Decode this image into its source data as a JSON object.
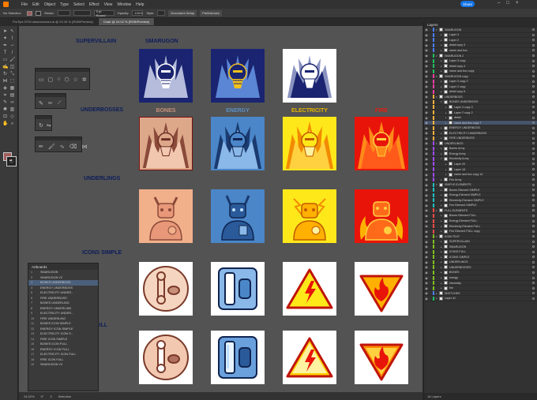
{
  "menu": [
    "File",
    "Edit",
    "Object",
    "Type",
    "Select",
    "Effect",
    "View",
    "Window",
    "Help"
  ],
  "share_label": "Share",
  "control": {
    "selection": "No Selection",
    "stroke_label": "Stroke:",
    "brush": "5 pt. Round",
    "opacity_label": "Opacity:",
    "opacity_value": "100%",
    "style_label": "Style:",
    "doc_setup": "Document Setup",
    "preferences": "Preferences"
  },
  "tabs": [
    {
      "label": "ProTips DTM dreamvectors.ai @ 24.15 % (RGB/Preview)",
      "active": false
    },
    {
      "label": "Chart @ 24.02 % (RGB/Preview)",
      "active": true
    }
  ],
  "canvas": {
    "rows": [
      "SUPERVILLAIN",
      "UNDERBOSSES",
      "UNDERLINGS",
      "ICONS SIMPLE",
      "ICONS FULL"
    ],
    "top_labels": [
      "SMARUGON"
    ],
    "element_labels": [
      "BONES",
      "ENERGY",
      "ELECTRICITY",
      "FIRE"
    ],
    "label_colors": [
      "#c8907a",
      "#5b8fc8",
      "#e8b800",
      "#e02010"
    ]
  },
  "artboards_panel": {
    "title": "Artboards",
    "items": [
      {
        "n": "1",
        "name": "SMARUGON"
      },
      {
        "n": "2",
        "name": "SMARUGON V2"
      },
      {
        "n": "3",
        "name": "BONES UNDERBOSS"
      },
      {
        "n": "4",
        "name": "ENERGY UNDERBOSS"
      },
      {
        "n": "5",
        "name": "ELECTRICITY UNDER..."
      },
      {
        "n": "6",
        "name": "FIRE UNDERBOSS"
      },
      {
        "n": "7",
        "name": "BONES UNDERLING"
      },
      {
        "n": "8",
        "name": "ENERGY UNDERLING"
      },
      {
        "n": "9",
        "name": "ELECTRICITY UNDER..."
      },
      {
        "n": "10",
        "name": "FIRE UNDERLING"
      },
      {
        "n": "11",
        "name": "BONES ICON SIMPLE"
      },
      {
        "n": "12",
        "name": "ENERGY ICON SIMPLE"
      },
      {
        "n": "13",
        "name": "ELECTRICITY ICON S..."
      },
      {
        "n": "14",
        "name": "FIRE ICON SIMPLE"
      },
      {
        "n": "15",
        "name": "BONES ICON FULL"
      },
      {
        "n": "16",
        "name": "ENERGY ICON FULL"
      },
      {
        "n": "17",
        "name": "ELECTRICITY ICON FULL"
      },
      {
        "n": "18",
        "name": "FIRE ICON FULL"
      },
      {
        "n": "19",
        "name": "SMARUGON V3"
      }
    ],
    "selected_index": 2
  },
  "layers_panel": {
    "title": "Layers",
    "footer": "16 Layers",
    "rows": [
      {
        "name": "SMARUGON",
        "indent": 0,
        "color": "#4a7cff",
        "open": true
      },
      {
        "name": "Layer 3",
        "indent": 1,
        "color": "#4a7cff"
      },
      {
        "name": "Layer 2",
        "indent": 1,
        "color": "#4a7cff"
      },
      {
        "name": "detail copy 3",
        "indent": 1,
        "color": "#4a7cff"
      },
      {
        "name": "name and box",
        "indent": 1,
        "color": "#4a7cff"
      },
      {
        "name": "SMARUGON 2",
        "indent": 0,
        "color": "#1fbf5f",
        "open": true
      },
      {
        "name": "Layer 3 copy",
        "indent": 1,
        "color": "#1fbf5f"
      },
      {
        "name": "detail copy 4",
        "indent": 1,
        "color": "#1fbf5f"
      },
      {
        "name": "name and box copy",
        "indent": 1,
        "color": "#1fbf5f"
      },
      {
        "name": "SMARUGON copy",
        "indent": 0,
        "color": "#ff3fa7",
        "open": true
      },
      {
        "name": "Layer 3 copy 2",
        "indent": 1,
        "color": "#ff3fa7"
      },
      {
        "name": "Layer 2 copy",
        "indent": 1,
        "color": "#ff3fa7"
      },
      {
        "name": "detail copy 5",
        "indent": 1,
        "color": "#ff3fa7"
      },
      {
        "name": "UNDERBOSS",
        "indent": 0,
        "color": "#ffb13b",
        "open": true
      },
      {
        "name": "BONES UNDERBOSS",
        "indent": 1,
        "color": "#ffb13b",
        "open": true
      },
      {
        "name": "Layer 3 copy 3",
        "indent": 2,
        "color": "#ffb13b"
      },
      {
        "name": "Layer 2 copy 2",
        "indent": 2,
        "color": "#ffb13b"
      },
      {
        "name": "detail",
        "indent": 2,
        "color": "#ffb13b"
      },
      {
        "name": "name and box copy 7",
        "indent": 2,
        "color": "#ffb13b",
        "sel": true
      },
      {
        "name": "ENERGY UNDERBOSS",
        "indent": 1,
        "color": "#ffb13b"
      },
      {
        "name": "ELECTRICITY UNDERBOSS",
        "indent": 1,
        "color": "#ffb13b"
      },
      {
        "name": "FIRE UNDERBOSS",
        "indent": 1,
        "color": "#ffb13b"
      },
      {
        "name": "UNDERLINGS",
        "indent": 0,
        "color": "#9f4aff",
        "open": true
      },
      {
        "name": "Bones Army",
        "indent": 1,
        "color": "#9f4aff"
      },
      {
        "name": "Energy Army",
        "indent": 1,
        "color": "#9f4aff"
      },
      {
        "name": "Electricity Army",
        "indent": 1,
        "color": "#9f4aff",
        "open": true
      },
      {
        "name": "Layer 20",
        "indent": 2,
        "color": "#9f4aff"
      },
      {
        "name": "Layer 18",
        "indent": 2,
        "color": "#9f4aff"
      },
      {
        "name": "name and box copy 14",
        "indent": 2,
        "color": "#9f4aff"
      },
      {
        "name": "Fire Army",
        "indent": 1,
        "color": "#9f4aff"
      },
      {
        "name": "SIMPLE ELEMENTS",
        "indent": 0,
        "color": "#1fbfbf",
        "open": true
      },
      {
        "name": "Bones Element SIMPLE",
        "indent": 1,
        "color": "#1fbfbf"
      },
      {
        "name": "Energy Element SIMPLE",
        "indent": 1,
        "color": "#1fbfbf"
      },
      {
        "name": "Electricity Element SIMPLE",
        "indent": 1,
        "color": "#1fbfbf"
      },
      {
        "name": "Fire Element SIMPLE",
        "indent": 1,
        "color": "#1fbfbf"
      },
      {
        "name": "FULL ELEMENTS",
        "indent": 0,
        "color": "#ff4a4a",
        "open": true
      },
      {
        "name": "Bones Element FULL",
        "indent": 1,
        "color": "#ff4a4a"
      },
      {
        "name": "Energy Element FULL",
        "indent": 1,
        "color": "#ff4a4a"
      },
      {
        "name": "Electricity Element FULL",
        "indent": 1,
        "color": "#ff4a4a"
      },
      {
        "name": "Fire Element FULL copy",
        "indent": 1,
        "color": "#ff4a4a"
      },
      {
        "name": "ICON TEXT",
        "indent": 0,
        "color": "#7fbf1f",
        "open": true
      },
      {
        "name": "SUPERVILLAIN",
        "indent": 1,
        "color": "#7fbf1f"
      },
      {
        "name": "SMARUGON",
        "indent": 1,
        "color": "#7fbf1f"
      },
      {
        "name": "ICONS FULL",
        "indent": 1,
        "color": "#7fbf1f"
      },
      {
        "name": "ICONS SIMPLE",
        "indent": 1,
        "color": "#7fbf1f"
      },
      {
        "name": "UNDERLINGS",
        "indent": 1,
        "color": "#7fbf1f"
      },
      {
        "name": "UNDERBOSSES",
        "indent": 1,
        "color": "#7fbf1f"
      },
      {
        "name": "BONES",
        "indent": 1,
        "color": "#7fbf1f"
      },
      {
        "name": "energy",
        "indent": 1,
        "color": "#7fbf1f"
      },
      {
        "name": "electricity",
        "indent": 1,
        "color": "#7fbf1f"
      },
      {
        "name": "fire",
        "indent": 1,
        "color": "#7fbf1f"
      },
      {
        "name": "SKETCHES",
        "indent": 0,
        "color": "#4a7cff"
      },
      {
        "name": "Layer 41",
        "indent": 0,
        "color": "#1fbf5f"
      }
    ]
  },
  "status": {
    "zoom": "24.02%",
    "rotate": "0°",
    "artboard_num": "3",
    "tool": "Selection"
  }
}
